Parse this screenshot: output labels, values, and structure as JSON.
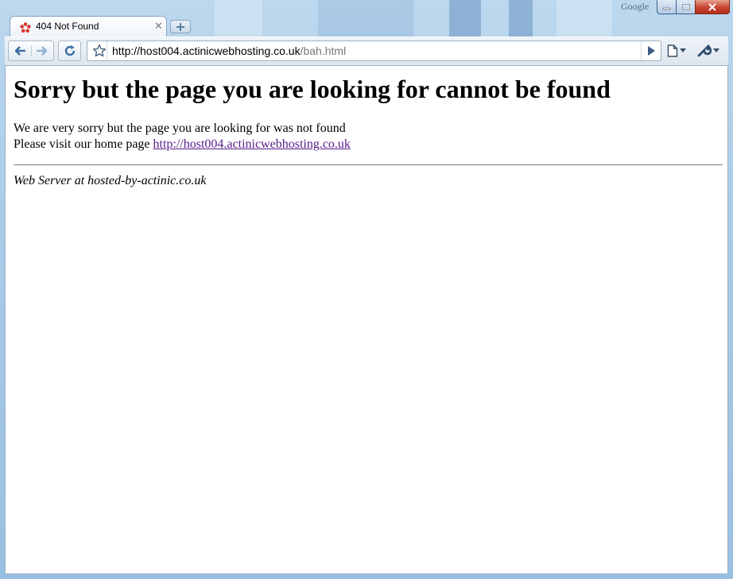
{
  "window": {
    "brand": "Google"
  },
  "tabs": [
    {
      "title": "404 Not Found"
    }
  ],
  "omnibox": {
    "url_host": "http://host004.actinicwebhosting.co.uk",
    "url_path": "/bah.html"
  },
  "page": {
    "heading": "Sorry but the page you are looking for cannot be found",
    "line1": "We are very sorry but the page you are looking for was not found",
    "line2_prefix": "Please visit our home page ",
    "home_link": "http://host004.actinicwebhosting.co.uk",
    "footer": "Web Server at hosted-by-actinic.co.uk"
  },
  "colors": {
    "link_visited": "#551a8b",
    "accent": "#3a6ea5"
  },
  "icons": {
    "tab_favicon": "actinic-flower-icon",
    "back": "back-arrow-icon",
    "forward": "forward-arrow-icon",
    "reload": "reload-icon",
    "bookmark": "star-icon",
    "go": "play-arrow-icon",
    "page_menu": "page-menu-icon",
    "tools_menu": "wrench-icon"
  }
}
